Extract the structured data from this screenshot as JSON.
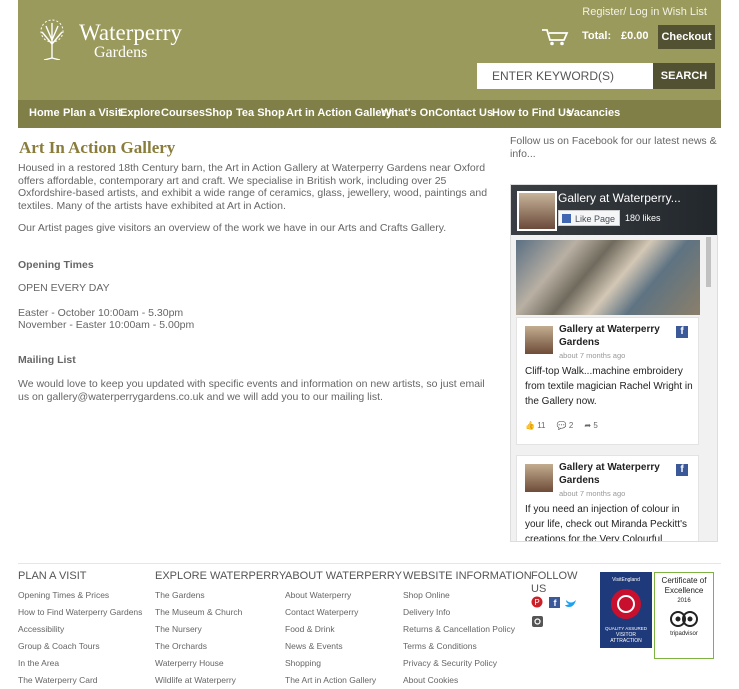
{
  "header": {
    "logo_line1": "Waterperry",
    "logo_line2": "Gardens",
    "register_login": "Register/ Log in",
    "wishlist": "Wish List",
    "total_label": "Total:",
    "total_value": "£0.00",
    "checkout": "Checkout",
    "search_placeholder": "ENTER KEYWORD(S)",
    "search_button": "SEARCH"
  },
  "nav": [
    "Home",
    "Plan a Visit",
    "Explore",
    "Courses",
    "Shop",
    "Tea Shop",
    "Art in Action Gallery",
    "What's On",
    "Contact Us",
    "How to Find Us",
    "Vacancies"
  ],
  "main": {
    "title": "Art In Action Gallery",
    "intro": "Housed in a restored 18th Century barn, the Art in Action Gallery at Waterperry Gardens near Oxford offers affordable, contemporary art and craft. We specialise in British work, including over 25 Oxfordshire-based artists, and exhibit a wide range of ceramics, glass, jewellery, wood, paintings and textiles. Many of the artists have exhibited at Art in Action.",
    "artists": "Our Artist pages give visitors an overview of the work we have in our Arts and Crafts Gallery.",
    "opening_heading": "Opening Times",
    "open_every_day": "OPEN EVERY DAY",
    "easter": "Easter - October 10:00am - 5.30pm",
    "november": "November - Easter 10:00am - 5.00pm",
    "mailing_heading": "Mailing List",
    "mailing_text": "We would love to keep you updated with specific events and information on new artists, so just email us on gallery@waterperrygardens.co.uk and we will add you to our mailing list."
  },
  "sidebar": {
    "follow": "Follow us on Facebook for our latest news & info...",
    "fb_page_name": "Gallery at Waterperry...",
    "fb_like": "Like Page",
    "fb_likes": "180 likes",
    "posts": [
      {
        "title": "Gallery at Waterperry Gardens",
        "time": "about 7 months ago",
        "text": "Cliff-top Walk...machine embroidery from textile magician Rachel Wright in the Gallery now.",
        "likes": "11",
        "comments": "2",
        "shares": "5"
      },
      {
        "title": "Gallery at Waterperry Gardens",
        "time": "about 7 months ago",
        "text": "If you need an injection of colour in your life, check out Miranda Peckitt's creations for the Very Colourful"
      }
    ]
  },
  "footer": {
    "plan": {
      "heading": "PLAN A VISIT",
      "items": [
        "Opening Times & Prices",
        "How to Find Waterperry Gardens",
        "Accessibility",
        "Group & Coach Tours",
        "In the Area",
        "The Waterperry Card"
      ]
    },
    "explore": {
      "heading": "EXPLORE WATERPERRY",
      "items": [
        "The Gardens",
        "The Museum & Church",
        "The Nursery",
        "The Orchards",
        "Waterperry House",
        "Wildlife at Waterperry"
      ]
    },
    "about": {
      "heading": "ABOUT WATERPERRY",
      "items": [
        "About Waterperry",
        "Contact Waterperry",
        "Food & Drink",
        "News & Events",
        "Shopping",
        "The Art in Action Gallery"
      ]
    },
    "website": {
      "heading": "WEBSITE INFORMATION",
      "items": [
        "Shop Online",
        "Delivery Info",
        "Returns & Cancellation Policy",
        "Terms & Conditions",
        "Privacy & Security Policy",
        "About Cookies"
      ]
    },
    "follow": {
      "line1": "FOLLOW",
      "line2": "US"
    },
    "badge_visit": {
      "top": "VisitEngland",
      "text": "QUALITY ASSURED VISITOR ATTRACTION"
    },
    "badge_trip": {
      "line1": "Certificate of",
      "line2": "Excellence",
      "year": "2016",
      "brand": "tripadvisor"
    }
  },
  "colors": {
    "header": "#9a9a5c",
    "nav": "#7f7f47",
    "button": "#525232",
    "title": "#8a7d3c",
    "facebook": "#3b5998"
  }
}
